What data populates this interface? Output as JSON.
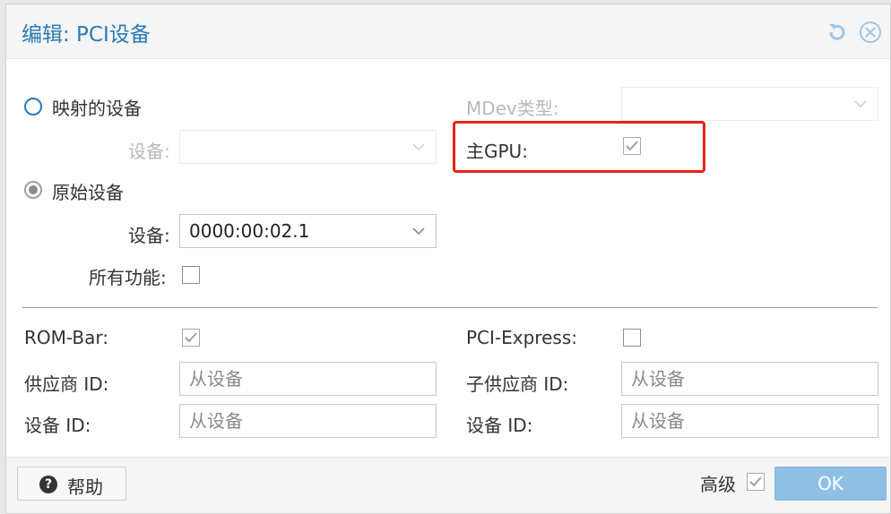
{
  "dialog": {
    "title": "编辑: PCI设备",
    "header_icons": [
      "reset-icon",
      "close-icon"
    ]
  },
  "mapped_device": {
    "radio_label": "映射的设备",
    "device_label": "设备:",
    "device_value": "",
    "mdev_label": "MDev类型:",
    "mdev_value": ""
  },
  "primary_gpu": {
    "label": "主GPU:",
    "checked": true
  },
  "raw_device": {
    "radio_label": "原始设备",
    "device_label": "设备:",
    "device_value": "0000:00:02.1",
    "all_functions_label": "所有功能:",
    "all_functions_checked": false
  },
  "advanced": {
    "rombar_label": "ROM-Bar:",
    "rombar_checked": true,
    "pcie_label": "PCI-Express:",
    "pcie_checked": false,
    "vendor_id_label": "供应商 ID:",
    "vendor_id_placeholder": "从设备",
    "subvendor_id_label": "子供应商 ID:",
    "subvendor_id_placeholder": "从设备",
    "device_id_label": "设备 ID:",
    "device_id_placeholder": "从设备",
    "subdevice_id_label": "设备 ID:",
    "subdevice_id_placeholder": "从设备"
  },
  "footer": {
    "help_label": "帮助",
    "advanced_label": "高级",
    "advanced_checked": true,
    "ok_label": "OK"
  },
  "colors": {
    "accent": "#2a7ab8",
    "ok_button": "#8ec0e6",
    "highlight_box": "#e8221b"
  }
}
